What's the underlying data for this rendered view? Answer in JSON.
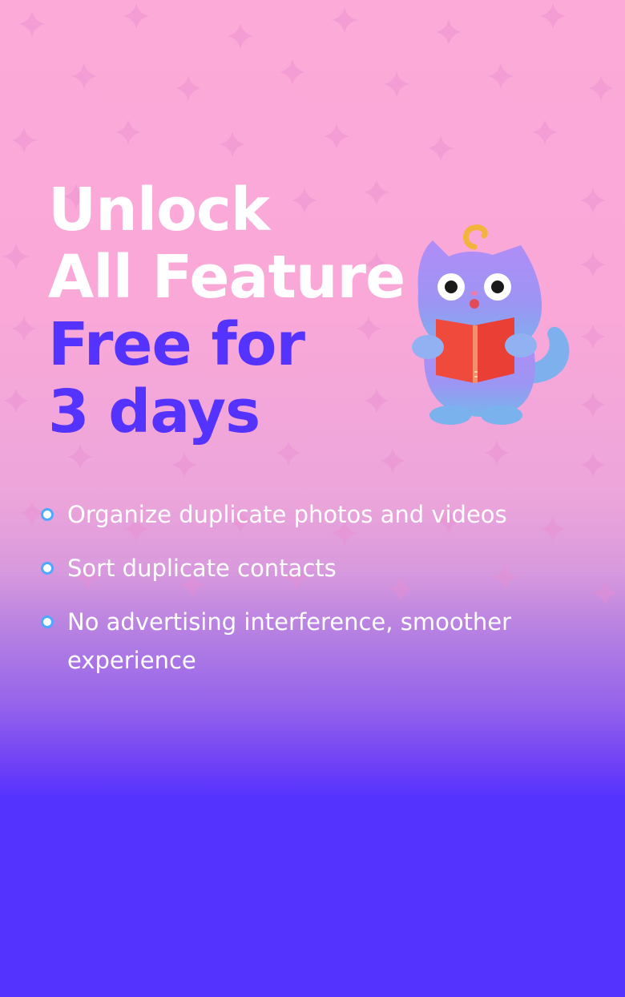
{
  "promo": {
    "headline": {
      "line1": "Unlock",
      "line2": "All Feature",
      "line3": "Free for",
      "line4": "3 days"
    },
    "features": [
      "Organize duplicate photos and videos",
      "Sort duplicate contacts",
      "No advertising interference, smoother experience"
    ],
    "mascot": {
      "icon": "cat-reading-book-icon"
    }
  },
  "colors": {
    "background_top": "#fcaad8",
    "background_bottom": "#5533ff",
    "headline_primary": "#ffffff",
    "headline_accent": "#5533ff",
    "bullet": "#4fa8ff",
    "mascot_body": "#a98cf5",
    "book": "#f04a3c"
  }
}
